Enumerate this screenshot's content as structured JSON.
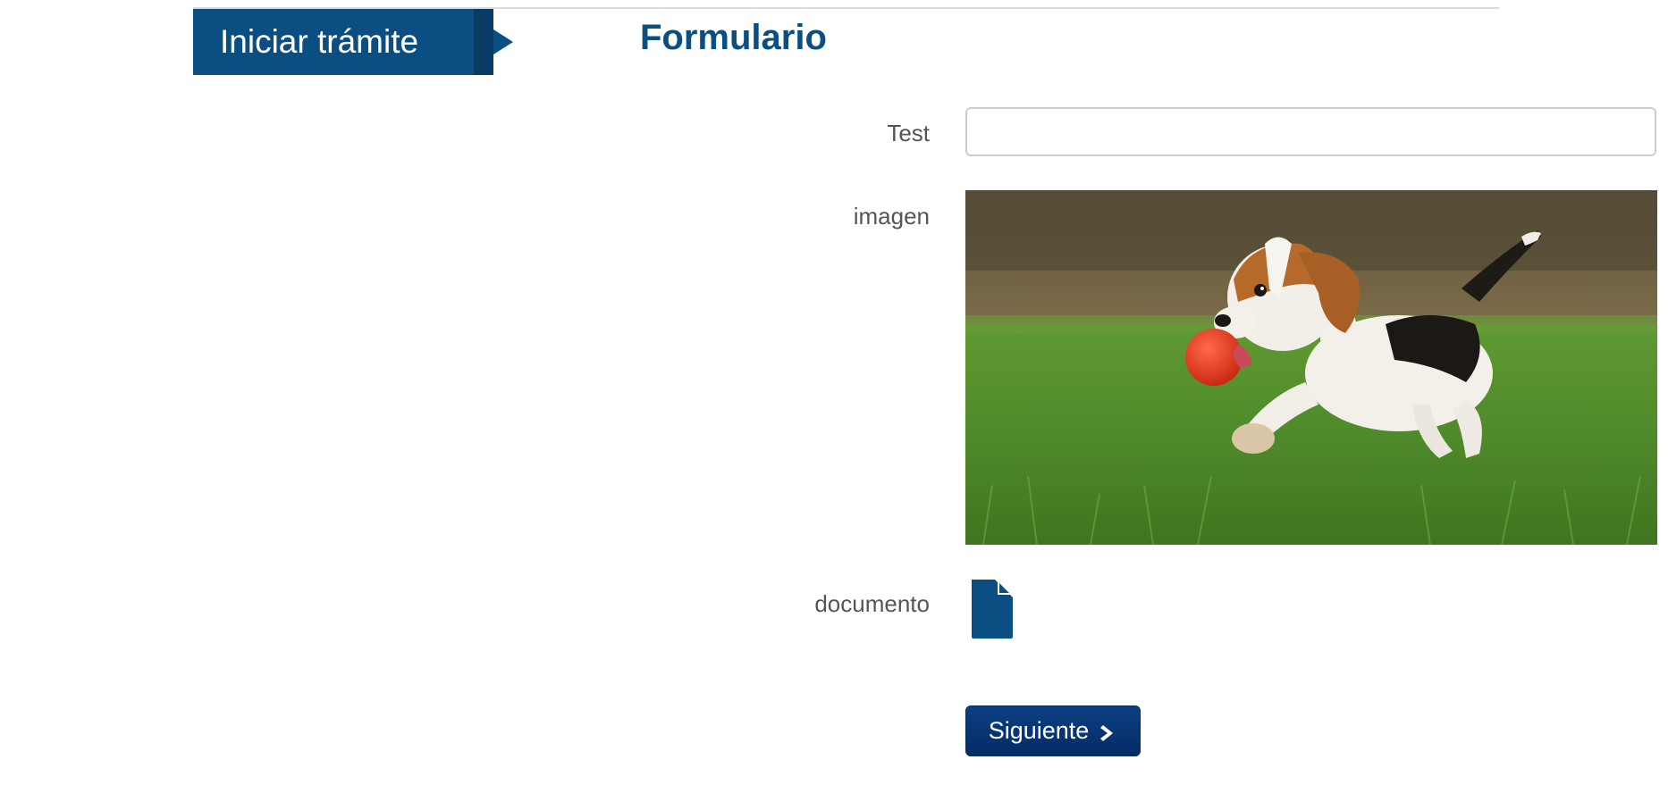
{
  "step": {
    "label": "Iniciar trámite"
  },
  "form": {
    "title": "Formulario",
    "fields": {
      "test": {
        "label": "Test",
        "value": "",
        "placeholder": ""
      },
      "imagen": {
        "label": "imagen"
      },
      "documento": {
        "label": "documento",
        "icon": "document-icon"
      }
    },
    "next_button": {
      "label": "Siguiente",
      "icon": "chevron-right-icon"
    }
  },
  "colors": {
    "brand": "#0b4f82",
    "brand_dark": "#083c65",
    "button": "#0a3f82",
    "label_text": "#555555"
  }
}
